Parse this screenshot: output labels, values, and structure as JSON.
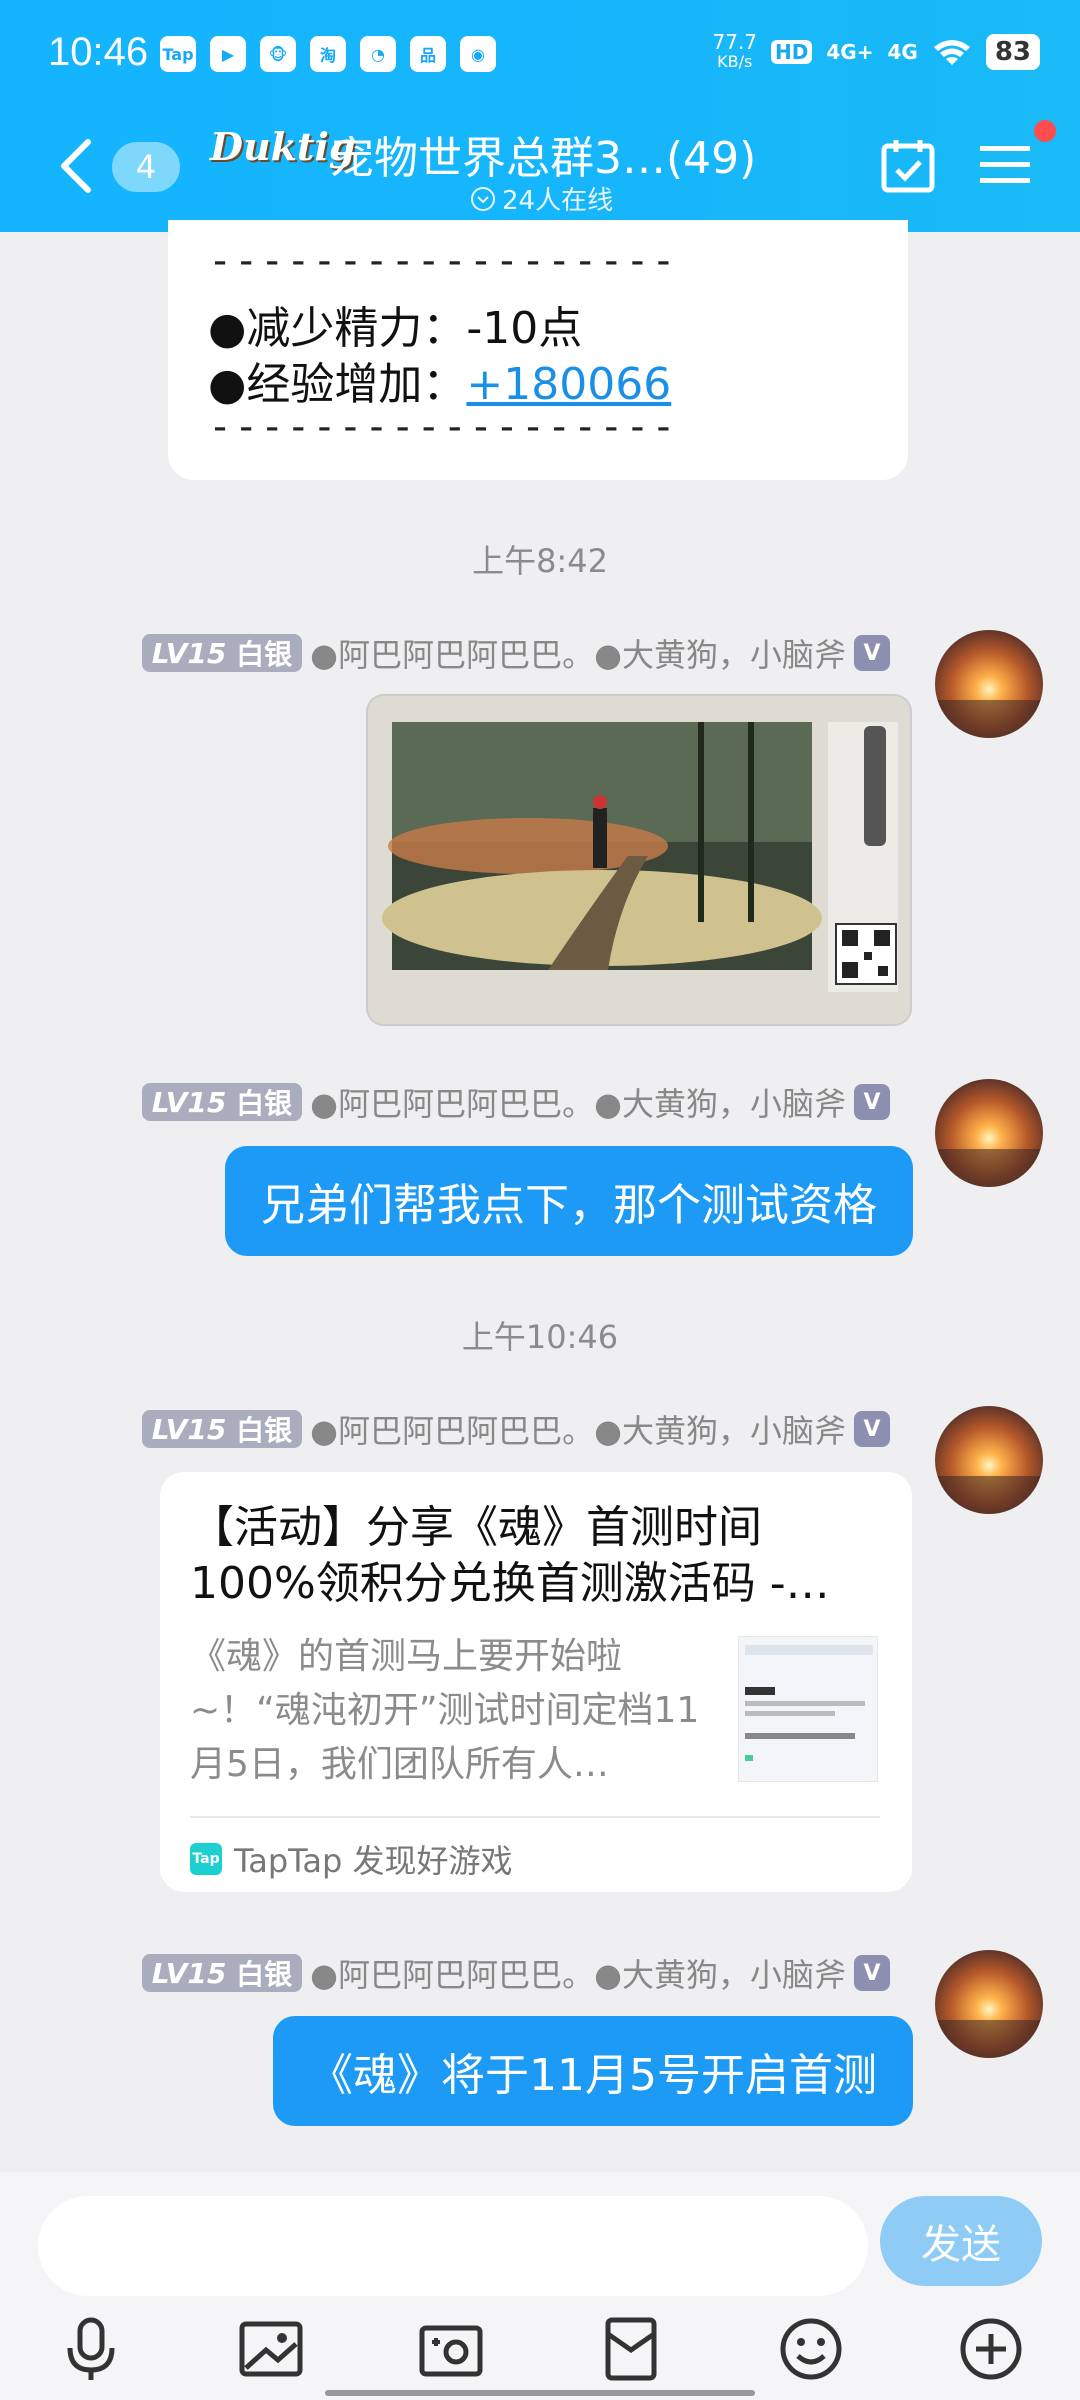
{
  "status_bar": {
    "time": "10:46",
    "net_speed_top": "77.7",
    "net_speed_unit": "KB/s",
    "signal1": "4G+",
    "signal2": "4G",
    "battery": "83",
    "app_icons": [
      "Tap",
      "▶",
      "🐵",
      "淘",
      "◔",
      "品",
      "◉"
    ]
  },
  "header": {
    "unread_count": "4",
    "logo_text": "Duktig",
    "group_title": "宠物世界总群3…(49)",
    "online_text": "24人在线"
  },
  "messages": {
    "top_card": {
      "dash": "------------------",
      "line1_label": "●减少精力：",
      "line1_value": "-10点",
      "line2_label": "●经验增加：",
      "line2_value": "+180066",
      "dash2": "------------------"
    },
    "time1": "上午8:42",
    "time2": "上午10:46",
    "sender": {
      "level": "LV15",
      "rank": "白银",
      "name": "●阿巴阿巴阿巴巴。●大黄狗，小脑斧",
      "badge": "V"
    },
    "text1": "兄弟们帮我点下，那个测试资格",
    "link_card": {
      "title": "【活动】分享《魂》首测时间100%领积分兑换首测激活码 -…",
      "desc": "《魂》的首测马上要开始啦~！“魂沌初开”测试时间定档11月5日，我们团队所有人…",
      "source": "TapTap 发现好游戏",
      "source_icon": "Tap"
    },
    "text2": "《魂》将于11月5号开启首测"
  },
  "input_bar": {
    "send_label": "发送",
    "placeholder": ""
  },
  "colors": {
    "header_blue": "#14b4ff",
    "bubble_blue": "#1d9af6",
    "send_disabled": "#8ecbf5"
  }
}
